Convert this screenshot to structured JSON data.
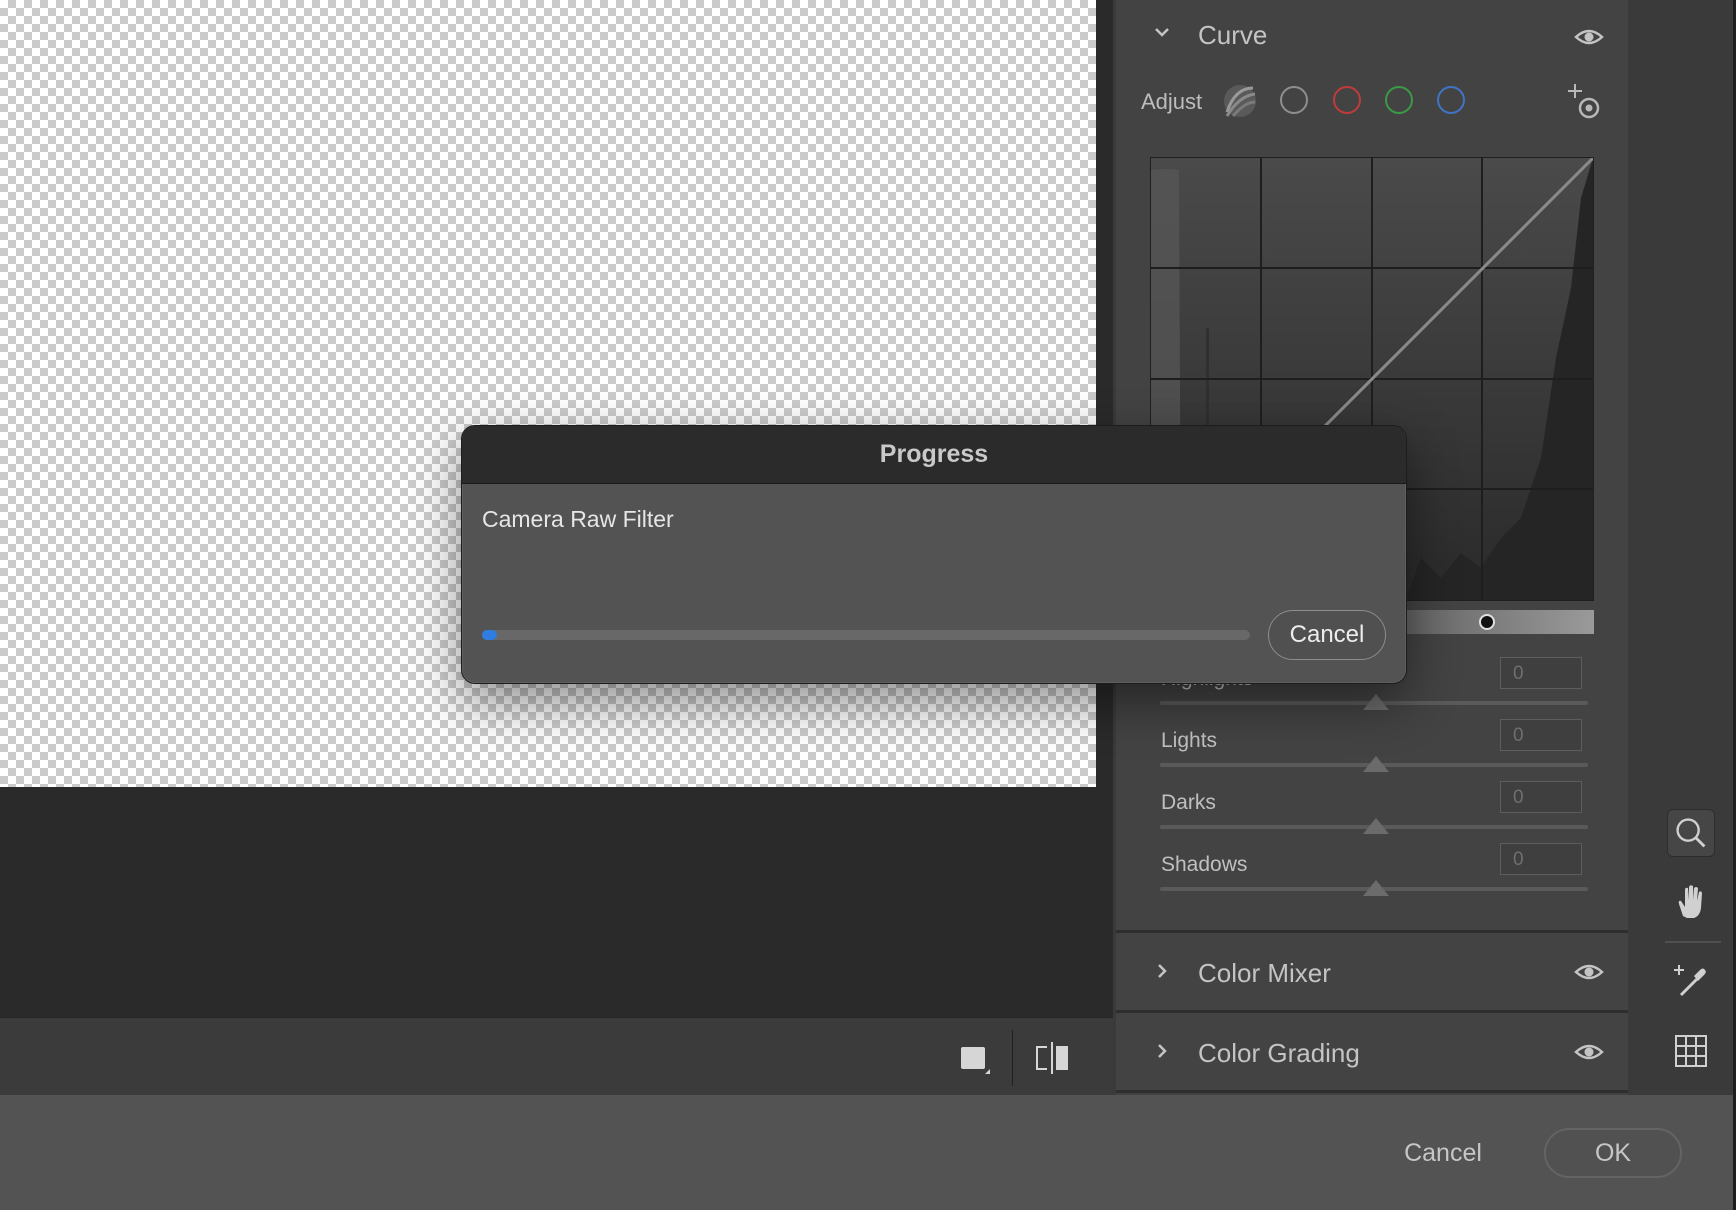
{
  "dialog": {
    "title": "Progress",
    "message": "Camera Raw Filter",
    "progress_fraction": 0.02,
    "cancel_label": "Cancel",
    "progress_color": "#2f7de0"
  },
  "curve": {
    "title": "Curve",
    "adjust_label": "Adjust",
    "channels": [
      "parametric",
      "luminance",
      "red",
      "green",
      "blue"
    ],
    "channel_colors": {
      "luminance": "#8e8e8e",
      "red": "#c23b3b",
      "green": "#3a9a45",
      "blue": "#3f74c6"
    },
    "sliders": [
      {
        "label": "Highlights",
        "value": "0"
      },
      {
        "label": "Lights",
        "value": "0"
      },
      {
        "label": "Darks",
        "value": "0"
      },
      {
        "label": "Shadows",
        "value": "0"
      }
    ]
  },
  "sections": {
    "color_mixer": "Color Mixer",
    "color_grading": "Color Grading"
  },
  "footer": {
    "cancel_label": "Cancel",
    "ok_label": "OK"
  },
  "icons": [
    "chevron-down-icon",
    "chevron-right-icon",
    "eye-icon",
    "parametric-curve-icon",
    "targeted-adjustment-icon",
    "zoom-icon",
    "hand-icon",
    "color-sampler-icon",
    "grid-icon",
    "single-view-icon",
    "before-after-icon"
  ]
}
